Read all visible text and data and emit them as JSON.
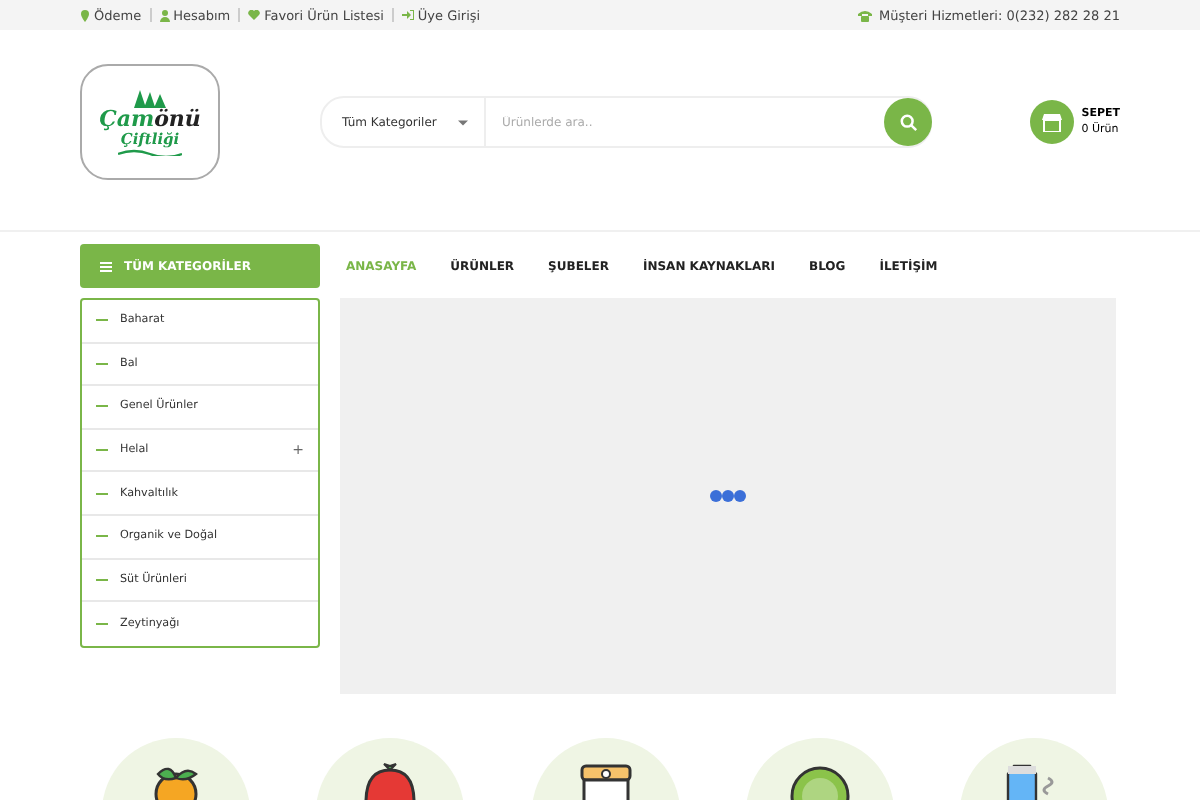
{
  "top_bar": {
    "links": [
      {
        "kind": "pin",
        "label": "Ödeme"
      },
      {
        "kind": "user",
        "label": "Hesabım"
      },
      {
        "kind": "heart",
        "label": "Favori Ürün Listesi"
      },
      {
        "kind": "login",
        "label": "Üye Girişi"
      }
    ],
    "phone": "Müşteri Hizmetleri: 0(232) 282 28 21"
  },
  "logo": {
    "word_a": "Çam",
    "word_b": "önü",
    "subtitle": "Çiftliği"
  },
  "search": {
    "category": "Tüm Kategoriler",
    "placeholder": "Ürünlerde ara.."
  },
  "cart": {
    "title": "SEPET",
    "count": "0 Ürün"
  },
  "categories_button": "TÜM KATEGORİLER",
  "nav": [
    {
      "label": "ANASAYFA",
      "selected": true
    },
    {
      "label": "ÜRÜNLER",
      "selected": false
    },
    {
      "label": "ŞUBELER",
      "selected": false
    },
    {
      "label": "İNSAN KAYNAKLARI",
      "selected": false
    },
    {
      "label": "BLOG",
      "selected": false
    },
    {
      "label": "İLETİŞİM",
      "selected": false
    }
  ],
  "categories": [
    {
      "label": "Baharat"
    },
    {
      "label": "Bal"
    },
    {
      "label": "Genel Ürünler"
    },
    {
      "label": "Helal",
      "expand_symbol": "+"
    },
    {
      "label": "Kahvaltılık"
    },
    {
      "label": "Organik ve Doğal"
    },
    {
      "label": "Süt Ürünleri"
    },
    {
      "label": "Zeytinyağı"
    }
  ],
  "slider": {
    "loading": true
  },
  "feature_icons": [
    {
      "kind": "fruit"
    },
    {
      "kind": "strawberry"
    },
    {
      "kind": "jar"
    },
    {
      "kind": "cabbage"
    },
    {
      "kind": "milk"
    }
  ]
}
